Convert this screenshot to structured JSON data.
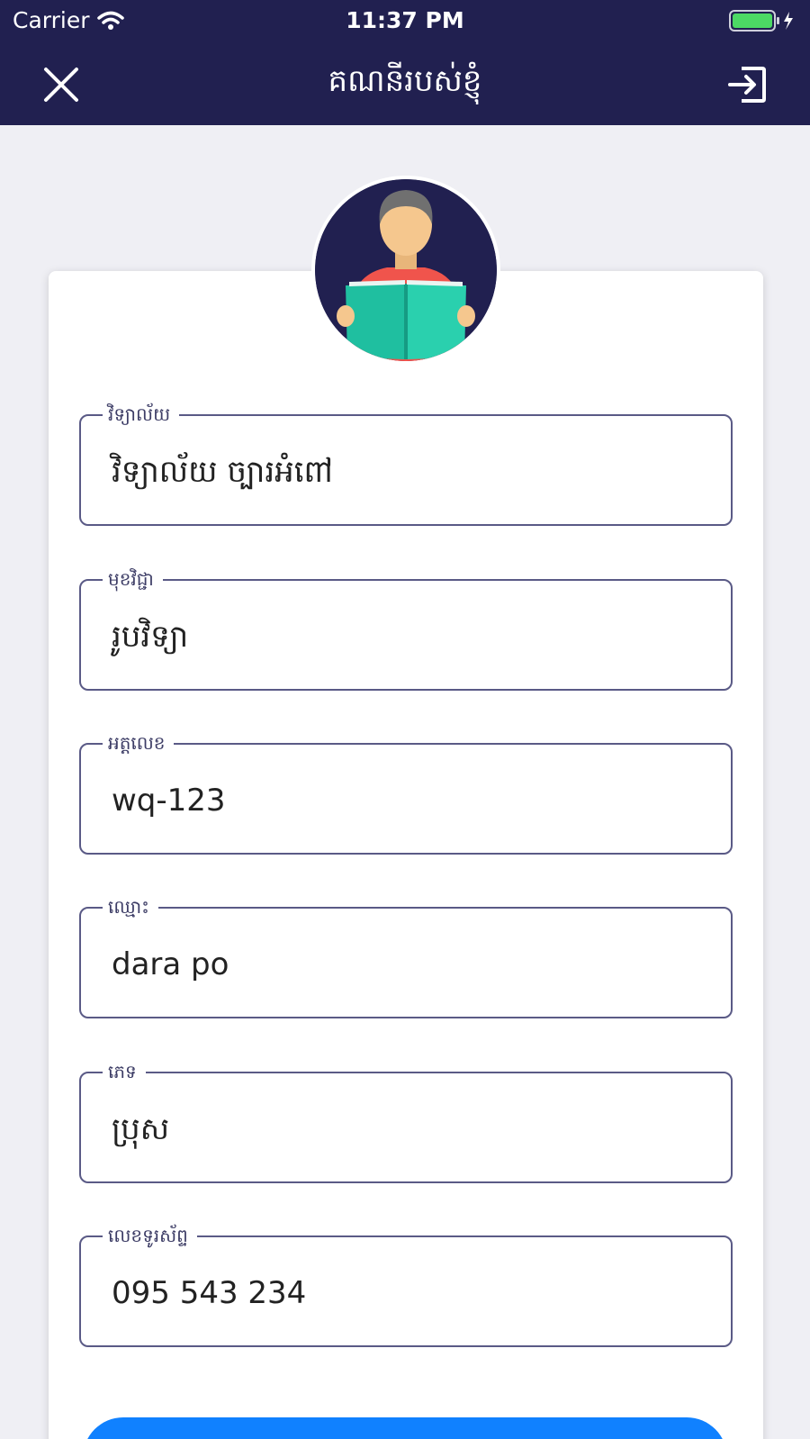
{
  "status_bar": {
    "carrier": "Carrier",
    "time": "11:37 PM",
    "wifi_icon": "wifi-icon",
    "battery_icon": "battery-charging-icon"
  },
  "nav": {
    "title": "គណនីរបស់ខ្ញុំ",
    "close_icon": "close-icon",
    "logout_icon": "logout-icon"
  },
  "profile": {
    "avatar_icon": "reader-avatar-icon"
  },
  "fields": [
    {
      "label": "វិទ្យាល័យ",
      "value": "វិទ្យាល័យ ច្បារអំពៅ"
    },
    {
      "label": "មុខវិជ្ជា",
      "value": "រូបវិទ្យា"
    },
    {
      "label": "អត្តលេខ",
      "value": "wq-123"
    },
    {
      "label": "ឈ្មោះ",
      "value": "dara po"
    },
    {
      "label": "ភេទ",
      "value": "ប្រុស"
    },
    {
      "label": "លេខទូរស័ព្ទ",
      "value": "095 543 234"
    }
  ],
  "colors": {
    "header_bg": "#212050",
    "page_bg": "#efeff4",
    "field_border": "#5a5a86",
    "button_blue": "#1081ff",
    "battery_green": "#4cd964"
  }
}
